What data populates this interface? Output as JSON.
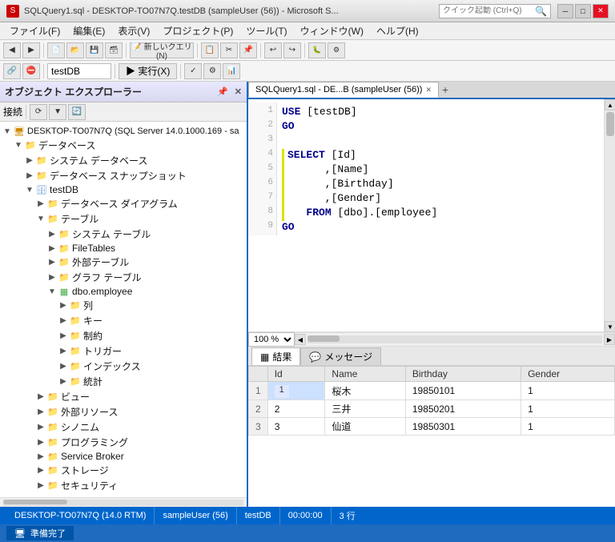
{
  "titleBar": {
    "text": "SQLQuery1.sql - DESKTOP-TO07N7Q.testDB (sampleUser (56)) - Microsoft S...",
    "searchPlaceholder": "クイック起動 (Ctrl+Q)"
  },
  "menu": {
    "items": [
      "ファイル(F)",
      "編集(E)",
      "表示(V)",
      "プロジェクト(P)",
      "ツール(T)",
      "ウィンドウ(W)",
      "ヘルプ(H)"
    ]
  },
  "toolbar2": {
    "dbname": "testDB",
    "execute": "▶ 実行(X)",
    "icons": [
      "◀",
      "▶",
      "⏹",
      "⟳",
      "📋",
      "✂",
      "📄"
    ]
  },
  "explorer": {
    "title": "オブジェクト エクスプローラー",
    "connectLabel": "接続",
    "tree": [
      {
        "id": "server",
        "indent": 0,
        "toggle": "▼",
        "icon": "🖥",
        "label": "DESKTOP-TO07N7Q (SQL Server 14.0.1000.169 - sa",
        "expanded": true
      },
      {
        "id": "databases",
        "indent": 1,
        "toggle": "▼",
        "icon": "📁",
        "label": "データベース",
        "expanded": true
      },
      {
        "id": "systemdbs",
        "indent": 2,
        "toggle": "▶",
        "icon": "📁",
        "label": "システム データベース",
        "expanded": false
      },
      {
        "id": "snapshots",
        "indent": 2,
        "toggle": "▶",
        "icon": "📁",
        "label": "データベース スナップショット",
        "expanded": false
      },
      {
        "id": "testDB",
        "indent": 2,
        "toggle": "▼",
        "icon": "🗄",
        "label": "testDB",
        "expanded": true
      },
      {
        "id": "diagrams",
        "indent": 3,
        "toggle": "▶",
        "icon": "📁",
        "label": "データベース ダイアグラム",
        "expanded": false
      },
      {
        "id": "tables",
        "indent": 3,
        "toggle": "▼",
        "icon": "📁",
        "label": "テーブル",
        "expanded": true
      },
      {
        "id": "systables",
        "indent": 4,
        "toggle": "▶",
        "icon": "📁",
        "label": "システム テーブル",
        "expanded": false
      },
      {
        "id": "filetables",
        "indent": 4,
        "toggle": "▶",
        "icon": "📁",
        "label": "FileTables",
        "expanded": false
      },
      {
        "id": "externaltables",
        "indent": 4,
        "toggle": "▶",
        "icon": "📁",
        "label": "外部テーブル",
        "expanded": false
      },
      {
        "id": "graphtables",
        "indent": 4,
        "toggle": "▶",
        "icon": "📁",
        "label": "グラフ テーブル",
        "expanded": false
      },
      {
        "id": "dboemployee",
        "indent": 4,
        "toggle": "▼",
        "icon": "📋",
        "label": "dbo.employee",
        "expanded": true
      },
      {
        "id": "columns",
        "indent": 5,
        "toggle": "▶",
        "icon": "📁",
        "label": "列",
        "expanded": false
      },
      {
        "id": "keys",
        "indent": 5,
        "toggle": "▶",
        "icon": "📁",
        "label": "キー",
        "expanded": false
      },
      {
        "id": "constraints",
        "indent": 5,
        "toggle": "▶",
        "icon": "📁",
        "label": "制約",
        "expanded": false
      },
      {
        "id": "triggers",
        "indent": 5,
        "toggle": "▶",
        "icon": "📁",
        "label": "トリガー",
        "expanded": false
      },
      {
        "id": "indexes",
        "indent": 5,
        "toggle": "▶",
        "icon": "📁",
        "label": "インデックス",
        "expanded": false
      },
      {
        "id": "statistics",
        "indent": 5,
        "toggle": "▶",
        "icon": "📁",
        "label": "統計",
        "expanded": false
      },
      {
        "id": "views",
        "indent": 3,
        "toggle": "▶",
        "icon": "📁",
        "label": "ビュー",
        "expanded": false
      },
      {
        "id": "externalresources",
        "indent": 3,
        "toggle": "▶",
        "icon": "📁",
        "label": "外部リソース",
        "expanded": false
      },
      {
        "id": "synonyms",
        "indent": 3,
        "toggle": "▶",
        "icon": "📁",
        "label": "シノニム",
        "expanded": false
      },
      {
        "id": "programming",
        "indent": 3,
        "toggle": "▶",
        "icon": "📁",
        "label": "プログラミング",
        "expanded": false
      },
      {
        "id": "servicebroker",
        "indent": 3,
        "toggle": "▶",
        "icon": "📁",
        "label": "Service Broker",
        "expanded": false
      },
      {
        "id": "storage",
        "indent": 3,
        "toggle": "▶",
        "icon": "📁",
        "label": "ストレージ",
        "expanded": false
      },
      {
        "id": "security",
        "indent": 3,
        "toggle": "▶",
        "icon": "📁",
        "label": "セキュリティ",
        "expanded": false
      }
    ]
  },
  "queryTab": {
    "label": "SQLQuery1.sql - DE...B (sampleUser (56))",
    "pinIcon": "📌"
  },
  "codeEditor": {
    "lines": [
      {
        "num": "",
        "content": "USE [testDB]"
      },
      {
        "num": "",
        "content": "GO"
      },
      {
        "num": "",
        "content": ""
      },
      {
        "num": "",
        "content": "SELECT [Id]"
      },
      {
        "num": "",
        "content": "      ,[Name]"
      },
      {
        "num": "",
        "content": "      ,[Birthday]"
      },
      {
        "num": "",
        "content": "      ,[Gender]"
      },
      {
        "num": "",
        "content": "  FROM [dbo].[employee]"
      },
      {
        "num": "",
        "content": "GO"
      }
    ]
  },
  "zoomLevel": "100 %",
  "resultsTabs": {
    "tabs": [
      "結果",
      "メッセージ"
    ],
    "activeTab": 0
  },
  "resultsTable": {
    "columns": [
      "",
      "Id",
      "Name",
      "Birthday",
      "Gender"
    ],
    "rows": [
      {
        "rowNum": "1",
        "id": "1",
        "name": "桜木",
        "birthday": "19850101",
        "gender": "1"
      },
      {
        "rowNum": "2",
        "id": "2",
        "name": "三井",
        "birthday": "19850201",
        "gender": "1"
      },
      {
        "rowNum": "3",
        "id": "3",
        "name": "仙道",
        "birthday": "19850301",
        "gender": "1"
      }
    ]
  },
  "statusBar": {
    "server": "DESKTOP-TO07N7Q (14.0 RTM)",
    "user": "sampleUser (56)",
    "db": "testDB",
    "time": "00:00:00",
    "rows": "3 行"
  },
  "bottomBar": {
    "readyLabel": "準備完了"
  }
}
